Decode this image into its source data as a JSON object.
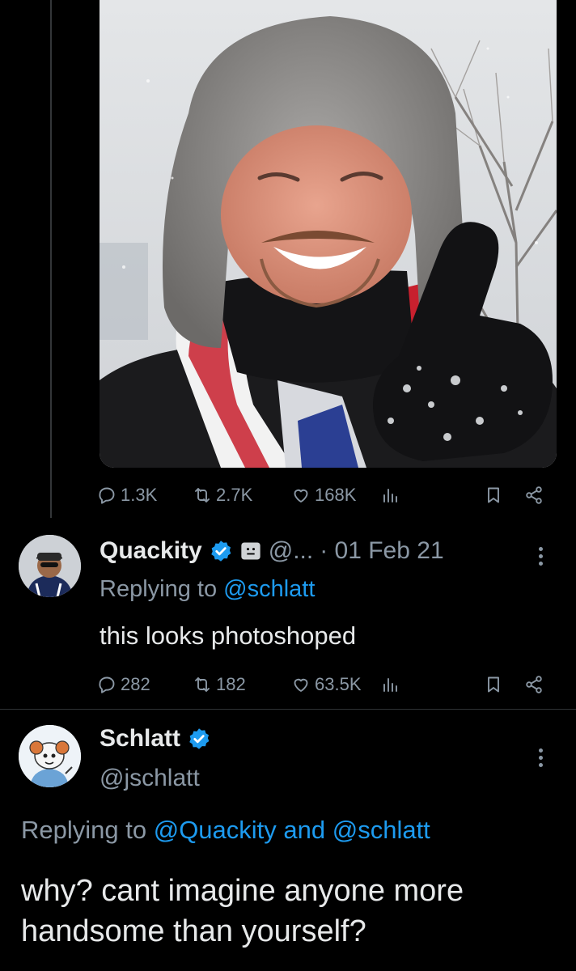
{
  "tweet1": {
    "photo_alt": "selfie in snow",
    "stats": {
      "replies": "1.3K",
      "retweets": "2.7K",
      "likes": "168K"
    }
  },
  "tweet2": {
    "display_name": "Quackity",
    "handle": "@...",
    "date": "· 01 Feb 21",
    "replying_prefix": "Replying to",
    "replying_handle": "@schlatt",
    "text": "this looks photoshoped",
    "stats": {
      "replies": "282",
      "retweets": "182",
      "likes": "63.5K"
    }
  },
  "tweet3": {
    "display_name": "Schlatt",
    "handle": "@jschlatt",
    "replying_prefix": "Replying to",
    "replying_handles": "@Quackity and @schlatt",
    "text": "why? cant imagine anyone more handsome than yourself?"
  },
  "colors": {
    "background": "#000000",
    "text": "#e7e9ea",
    "muted": "#8b98a5",
    "accent": "#1d9bf0"
  }
}
